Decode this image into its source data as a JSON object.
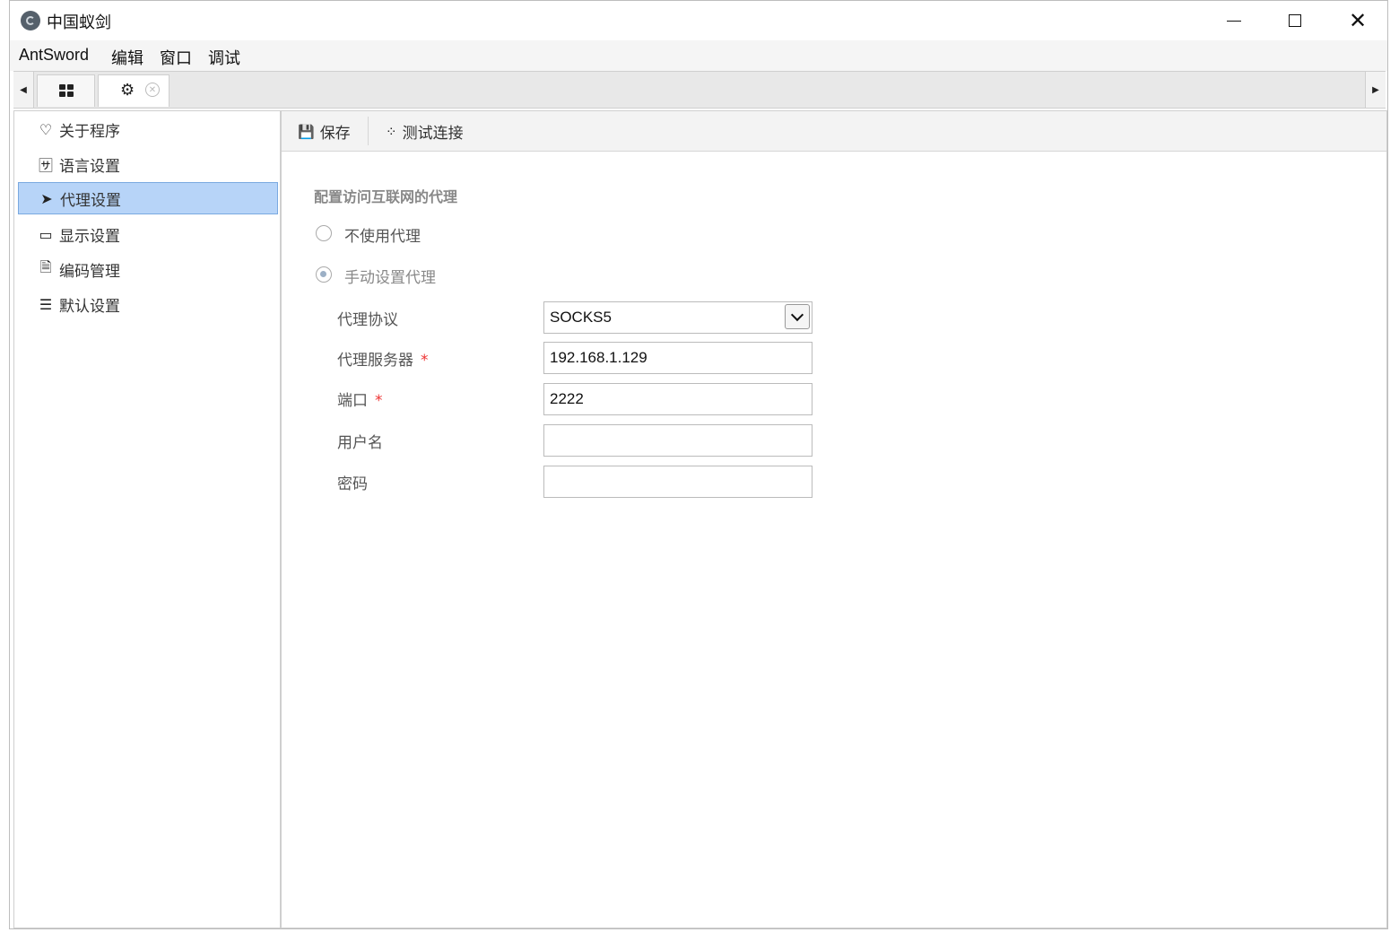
{
  "window": {
    "title": "中国蚁剑"
  },
  "menu": [
    "AntSword",
    "编辑",
    "窗口",
    "调试"
  ],
  "sidebar": {
    "items": [
      {
        "label": "关于程序",
        "icon": "heart-icon"
      },
      {
        "label": "语言设置",
        "icon": "translate-icon"
      },
      {
        "label": "代理设置",
        "icon": "paper-plane-icon",
        "active": true
      },
      {
        "label": "显示设置",
        "icon": "monitor-icon"
      },
      {
        "label": "编码管理",
        "icon": "code-file-icon"
      },
      {
        "label": "默认设置",
        "icon": "sliders-icon"
      }
    ]
  },
  "toolbar": {
    "save_label": "保存",
    "test_label": "测试连接"
  },
  "form": {
    "section_title": "配置访问互联网的代理",
    "radio_no_proxy": "不使用代理",
    "radio_manual": "手动设置代理",
    "protocol_label": "代理协议",
    "protocol_value": "SOCKS5",
    "server_label": "代理服务器",
    "server_value": "192.168.1.129",
    "port_label": "端口",
    "port_value": "2222",
    "username_label": "用户名",
    "username_value": "",
    "password_label": "密码",
    "password_value": "",
    "required_mark": "*"
  }
}
